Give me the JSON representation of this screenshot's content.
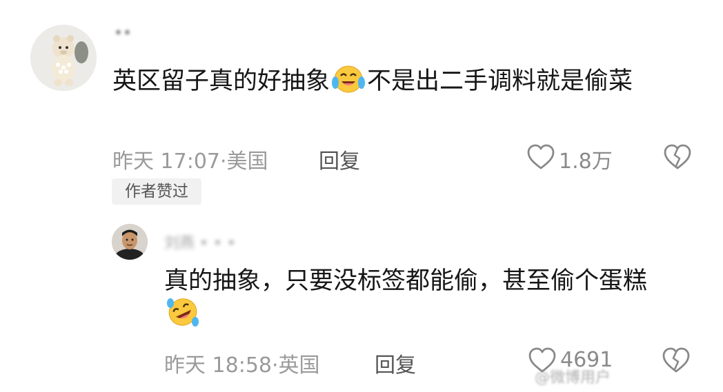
{
  "comments": [
    {
      "username": "••",
      "text_before_emoji": "英区留子真的好抽象",
      "text_after_emoji": "不是出二手调料就是偷菜",
      "emoji": "crying-laughing-face",
      "time": "昨天 17:07",
      "location": "美国",
      "reply_label": "回复",
      "likes": "1.8万",
      "badge": "作者赞过"
    },
    {
      "username": "刘燕 • • •",
      "text": "真的抽象，只要没标签都能偷，甚至偷个蛋糕",
      "emoji": "rolling-laughing-face",
      "time": "昨天 18:58",
      "location": "英国",
      "reply_label": "回复",
      "likes": "4691"
    }
  ],
  "watermark": "@微博用户",
  "colors": {
    "text": "#161616",
    "meta": "#9a9a9a",
    "badge_bg": "#f1f1f1"
  }
}
